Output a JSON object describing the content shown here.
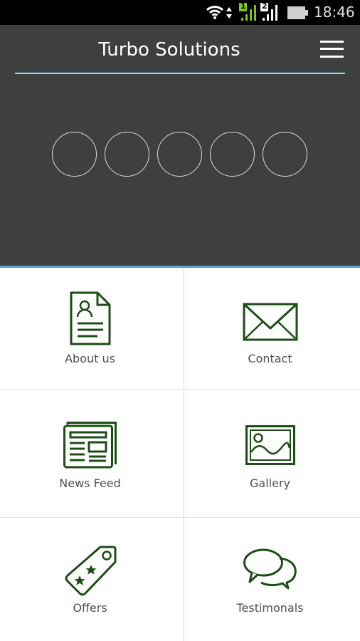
{
  "status_bar": {
    "time": "18:46",
    "sim1_label": "1",
    "sim2_label": "2",
    "colors": {
      "sim1": "#7fc31c",
      "sim2": "#ffffff",
      "battery": "#d0d0d0"
    }
  },
  "header": {
    "title": "Turbo Solutions",
    "menu_icon": "hamburger-menu-icon",
    "slider_dots": 5,
    "colors": {
      "background": "#3e403f",
      "divider": "#9fd3e6",
      "accent": "#4fa8cc"
    }
  },
  "menu": {
    "icon_color": "#1b4d14",
    "items": [
      {
        "label": "About us",
        "icon": "profile-document-icon"
      },
      {
        "label": "Contact",
        "icon": "envelope-icon"
      },
      {
        "label": "News Feed",
        "icon": "newspaper-icon"
      },
      {
        "label": "Gallery",
        "icon": "picture-frame-icon"
      },
      {
        "label": "Offers",
        "icon": "price-tag-icon"
      },
      {
        "label": "Testimonals",
        "icon": "speech-bubbles-icon"
      }
    ]
  }
}
